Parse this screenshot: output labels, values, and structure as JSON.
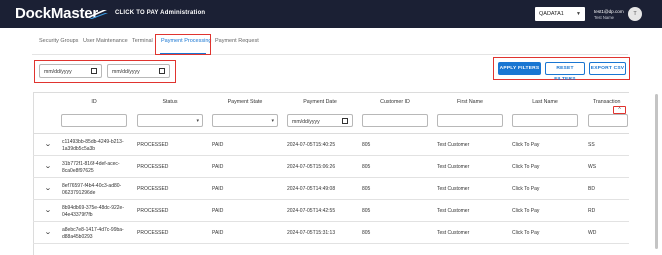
{
  "header": {
    "logo_text": "DockMaster",
    "app_title": "CLICK TO PAY Administration",
    "environment_selected": "QADATA1",
    "user_email": "test1@dp.com",
    "user_name": "Test Name",
    "avatar_initial": "T"
  },
  "tabs": [
    {
      "label": "Security Groups",
      "active": false
    },
    {
      "label": "User Maintenance",
      "active": false
    },
    {
      "label": "Terminal",
      "active": false
    },
    {
      "label": "Payment Processing",
      "active": true
    },
    {
      "label": "Payment Request",
      "active": false
    }
  ],
  "filters": {
    "date_from_placeholder": "mm/dd/yyyy",
    "date_to_placeholder": "mm/dd/yyyy",
    "apply_label": "APPLY FILTERS",
    "reset_label": "RESET FILTERS",
    "export_label": "EXPORT CSV"
  },
  "grid": {
    "columns": [
      "ID",
      "Status",
      "Payment State",
      "Payment Date",
      "Customer ID",
      "First Name",
      "Last Name",
      "Transaction"
    ],
    "payment_date_filter_placeholder": "mm/dd/yyyy",
    "sort_icon": "^",
    "rows": [
      {
        "id_line1": "c11493bb-85db-4249-b213-",
        "id_line2": "1a39db5c5a3b",
        "status": "PROCESSED",
        "payment_state": "PAID",
        "payment_date": "2024-07-05T15:40:25",
        "customer_id": "805",
        "first_name": "Test Customer",
        "last_name": "Click To Pay",
        "transaction": "SS"
      },
      {
        "id_line1": "31b772f1-816f-4def-acec-",
        "id_line2": "8ca0e8f97625",
        "status": "PROCESSED",
        "payment_state": "PAID",
        "payment_date": "2024-07-05T15:06:26",
        "customer_id": "805",
        "first_name": "Test Customer",
        "last_name": "Click To Pay",
        "transaction": "WS"
      },
      {
        "id_line1": "8ef76597-f4b4-40c3-ad80-",
        "id_line2": "0623791296de",
        "status": "PROCESSED",
        "payment_state": "PAID",
        "payment_date": "2024-07-05T14:49:08",
        "customer_id": "805",
        "first_name": "Test Customer",
        "last_name": "Click To Pay",
        "transaction": "BD"
      },
      {
        "id_line1": "8b94db69-375e-48dc-922e-",
        "id_line2": "04e43379f7fb",
        "status": "PROCESSED",
        "payment_state": "PAID",
        "payment_date": "2024-07-05T14:42:55",
        "customer_id": "805",
        "first_name": "Test Customer",
        "last_name": "Click To Pay",
        "transaction": "RD"
      },
      {
        "id_line1": "a8ebc7e8-1417-4d7c-99ba-",
        "id_line2": "d88a45b0293",
        "status": "PROCESSED",
        "payment_state": "PAID",
        "payment_date": "2024-07-05T15:31:13",
        "customer_id": "805",
        "first_name": "Test Customer",
        "last_name": "Click To Pay",
        "transaction": "WD"
      }
    ]
  },
  "icons": {
    "calendar": "calendar-icon",
    "expand": "chevron-down-icon",
    "dropdown": "caret-down-icon",
    "sort": "sort-icon"
  },
  "colors": {
    "topbar": "#1b2034",
    "accent": "#1976d2",
    "highlight_box": "#e0342f"
  }
}
